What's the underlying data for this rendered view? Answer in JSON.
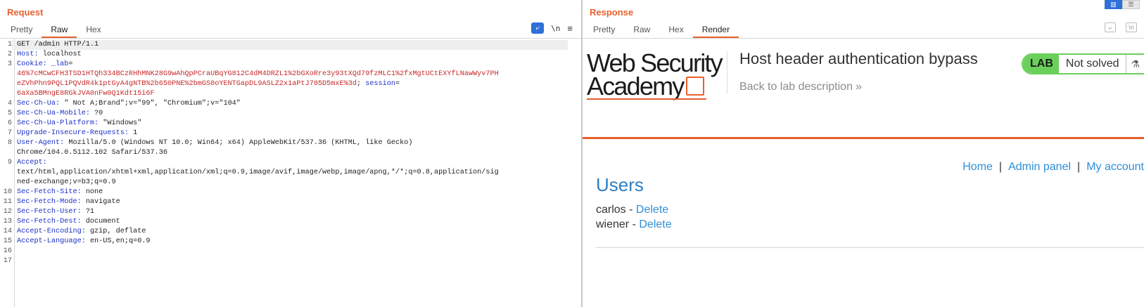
{
  "request": {
    "title": "Request",
    "tabs": [
      "Pretty",
      "Raw",
      "Hex"
    ],
    "tool_wrap_icon": "wrap-lines-icon",
    "tool_newline": "\\n",
    "tool_menu": "≡",
    "lines": [
      {
        "n": "1",
        "parts": [
          {
            "t": "GET /admin HTTP/1.1",
            "c": ""
          }
        ]
      },
      {
        "n": "2",
        "parts": [
          {
            "t": "Host:",
            "c": "key"
          },
          {
            "t": " localhost",
            "c": ""
          }
        ]
      },
      {
        "n": "3",
        "parts": [
          {
            "t": "Cookie:",
            "c": "key"
          },
          {
            "t": " _lab",
            "c": "blue"
          },
          {
            "t": "=",
            "c": ""
          }
        ]
      },
      {
        "n": "",
        "parts": [
          {
            "t": "46%7cMCwCFH3TSD1HTQh334BCzRHhMNK28G9wAhQpPCraUBqYG812C4dM4DRZL1%2bGXoRre3y93tXQd79fzMLC1%2fxMgtUCtEXYfLNawWyv7PH",
            "c": "red"
          }
        ]
      },
      {
        "n": "",
        "parts": [
          {
            "t": "eZVhPhn9PQL1PQVdR4k1ptGyA4gNTB%2b650PNE%2bmGS0oYENTGapDL9ASLZ2x1aPtJ705D5mxE%3d",
            "c": "red"
          },
          {
            "t": "; ",
            "c": ""
          },
          {
            "t": "session",
            "c": "blue"
          },
          {
            "t": "=",
            "c": ""
          }
        ]
      },
      {
        "n": "",
        "parts": [
          {
            "t": "6aXa5BMngE8RGkJVA0nFw0Q1Kdt15i6F",
            "c": "red"
          }
        ]
      },
      {
        "n": "4",
        "parts": [
          {
            "t": "Sec-Ch-Ua:",
            "c": "key"
          },
          {
            "t": " \" Not A;Brand\";v=\"99\", \"Chromium\";v=\"104\"",
            "c": ""
          }
        ]
      },
      {
        "n": "5",
        "parts": [
          {
            "t": "Sec-Ch-Ua-Mobile:",
            "c": "key"
          },
          {
            "t": " ?0",
            "c": ""
          }
        ]
      },
      {
        "n": "6",
        "parts": [
          {
            "t": "Sec-Ch-Ua-Platform:",
            "c": "key"
          },
          {
            "t": " \"Windows\"",
            "c": ""
          }
        ]
      },
      {
        "n": "7",
        "parts": [
          {
            "t": "Upgrade-Insecure-Requests:",
            "c": "key"
          },
          {
            "t": " 1",
            "c": ""
          }
        ]
      },
      {
        "n": "8",
        "parts": [
          {
            "t": "User-Agent:",
            "c": "key"
          },
          {
            "t": " Mozilla/5.0 (Windows NT 10.0; Win64; x64) AppleWebKit/537.36 (KHTML, like Gecko)",
            "c": ""
          }
        ]
      },
      {
        "n": "",
        "parts": [
          {
            "t": "Chrome/104.0.5112.102 Safari/537.36",
            "c": ""
          }
        ]
      },
      {
        "n": "9",
        "parts": [
          {
            "t": "Accept:",
            "c": "key"
          }
        ]
      },
      {
        "n": "",
        "parts": [
          {
            "t": "text/html,application/xhtml+xml,application/xml;q=0.9,image/avif,image/webp,image/apng,*/*;q=0.8,application/sig",
            "c": ""
          }
        ]
      },
      {
        "n": "",
        "parts": [
          {
            "t": "ned-exchange;v=b3;q=0.9",
            "c": ""
          }
        ]
      },
      {
        "n": "10",
        "parts": [
          {
            "t": "Sec-Fetch-Site:",
            "c": "key"
          },
          {
            "t": " none",
            "c": ""
          }
        ]
      },
      {
        "n": "11",
        "parts": [
          {
            "t": "Sec-Fetch-Mode:",
            "c": "key"
          },
          {
            "t": " navigate",
            "c": ""
          }
        ]
      },
      {
        "n": "12",
        "parts": [
          {
            "t": "Sec-Fetch-User:",
            "c": "key"
          },
          {
            "t": " ?1",
            "c": ""
          }
        ]
      },
      {
        "n": "13",
        "parts": [
          {
            "t": "Sec-Fetch-Dest:",
            "c": "key"
          },
          {
            "t": " document",
            "c": ""
          }
        ]
      },
      {
        "n": "14",
        "parts": [
          {
            "t": "Accept-Encoding:",
            "c": "key"
          },
          {
            "t": " gzip, deflate",
            "c": ""
          }
        ]
      },
      {
        "n": "15",
        "parts": [
          {
            "t": "Accept-Language:",
            "c": "key"
          },
          {
            "t": " en-US,en;q=0.9",
            "c": ""
          }
        ]
      },
      {
        "n": "16",
        "parts": []
      },
      {
        "n": "17",
        "parts": []
      }
    ]
  },
  "response": {
    "title": "Response",
    "tabs": [
      "Pretty",
      "Raw",
      "Hex",
      "Render"
    ],
    "tool_newline": "\\n",
    "render": {
      "logo_line1": "Web Security",
      "logo_line2": "Academy",
      "lab_title": "Host header authentication bypass",
      "back_link": "Back to lab description",
      "back_chevron": "»",
      "lab_badge": "LAB",
      "lab_status": "Not solved",
      "flask_icon": "⚗",
      "nav": {
        "home": "Home",
        "sep": "|",
        "admin": "Admin panel",
        "account": "My account"
      },
      "users_heading": "Users",
      "users": [
        {
          "name": "carlos",
          "dash": " - ",
          "action": "Delete"
        },
        {
          "name": "wiener",
          "dash": " - ",
          "action": "Delete"
        }
      ]
    }
  },
  "colors": {
    "accent": "#e8602c",
    "link": "#2e8fd6",
    "lab_green": "#6bd05b"
  }
}
